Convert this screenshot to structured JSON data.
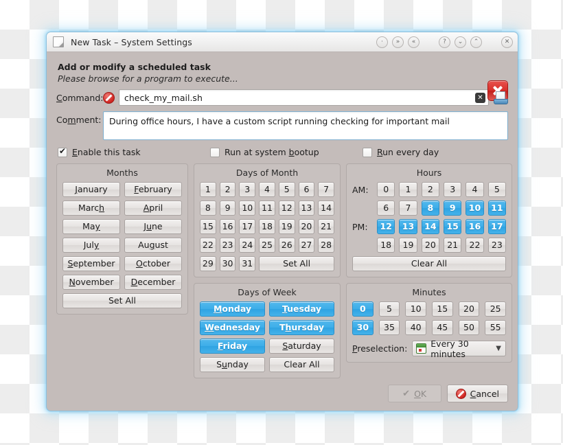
{
  "window": {
    "title": "New Task – System Settings",
    "icon": "document-icon",
    "titlebar_buttons": [
      {
        "name": "keep-above-button",
        "glyph": "·"
      },
      {
        "name": "shade-down-button",
        "glyph": "»"
      },
      {
        "name": "shade-up-button",
        "glyph": "«"
      },
      {
        "name": "help-button",
        "glyph": "?"
      },
      {
        "name": "minimize-button",
        "glyph": "⌄"
      },
      {
        "name": "maximize-button",
        "glyph": "⌃"
      },
      {
        "name": "close-button",
        "glyph": "✕"
      }
    ]
  },
  "header": {
    "title": "Add or modify a scheduled task",
    "subtitle": "Please browse for a program to execute..."
  },
  "command": {
    "label": "Command:",
    "label_mnemonic": "C",
    "value": "check_my_mail.sh",
    "error_icon": "error-prohibited-icon",
    "clear_icon": "clear-text-icon",
    "browse_icon": "browse-file-icon"
  },
  "comment": {
    "label": "Comment:",
    "label_mnemonic": "m",
    "value": "During office hours, I have a custom script running checking for important mail"
  },
  "options": [
    {
      "label": "Enable this task",
      "mnemonic": "E",
      "checked": true,
      "name": "enable-task-checkbox"
    },
    {
      "label": "Run at system bootup",
      "mnemonic": "b",
      "checked": false,
      "name": "run-at-bootup-checkbox"
    },
    {
      "label": "Run every day",
      "mnemonic": "R",
      "checked": false,
      "name": "run-every-day-checkbox"
    }
  ],
  "months": {
    "title": "Months",
    "items": [
      {
        "label": "January",
        "mnemonic": "J",
        "selected": false
      },
      {
        "label": "February",
        "mnemonic": "F",
        "selected": false
      },
      {
        "label": "March",
        "mnemonic": "h",
        "selected": false
      },
      {
        "label": "April",
        "mnemonic": "A",
        "selected": false
      },
      {
        "label": "May",
        "mnemonic": "y",
        "selected": false
      },
      {
        "label": "June",
        "mnemonic": "u",
        "selected": false
      },
      {
        "label": "July",
        "mnemonic": "y",
        "selected": false
      },
      {
        "label": "August",
        "mnemonic": "g",
        "selected": false
      },
      {
        "label": "September",
        "mnemonic": "S",
        "selected": false
      },
      {
        "label": "October",
        "mnemonic": "O",
        "selected": false
      },
      {
        "label": "November",
        "mnemonic": "N",
        "selected": false
      },
      {
        "label": "December",
        "mnemonic": "D",
        "selected": false
      }
    ],
    "action": "Set All"
  },
  "days_of_month": {
    "title": "Days of Month",
    "items": [
      {
        "label": "1",
        "selected": false
      },
      {
        "label": "2",
        "selected": false
      },
      {
        "label": "3",
        "selected": false
      },
      {
        "label": "4",
        "selected": false
      },
      {
        "label": "5",
        "selected": false
      },
      {
        "label": "6",
        "selected": false
      },
      {
        "label": "7",
        "selected": false
      },
      {
        "label": "8",
        "selected": false
      },
      {
        "label": "9",
        "selected": false
      },
      {
        "label": "10",
        "selected": false
      },
      {
        "label": "11",
        "selected": false
      },
      {
        "label": "12",
        "selected": false
      },
      {
        "label": "13",
        "selected": false
      },
      {
        "label": "14",
        "selected": false
      },
      {
        "label": "15",
        "selected": false
      },
      {
        "label": "16",
        "selected": false
      },
      {
        "label": "17",
        "selected": false
      },
      {
        "label": "18",
        "selected": false
      },
      {
        "label": "19",
        "selected": false
      },
      {
        "label": "20",
        "selected": false
      },
      {
        "label": "21",
        "selected": false
      },
      {
        "label": "22",
        "selected": false
      },
      {
        "label": "23",
        "selected": false
      },
      {
        "label": "24",
        "selected": false
      },
      {
        "label": "25",
        "selected": false
      },
      {
        "label": "26",
        "selected": false
      },
      {
        "label": "27",
        "selected": false
      },
      {
        "label": "28",
        "selected": false
      },
      {
        "label": "29",
        "selected": false
      },
      {
        "label": "30",
        "selected": false
      },
      {
        "label": "31",
        "selected": false
      }
    ],
    "action": "Set All"
  },
  "hours": {
    "title": "Hours",
    "am_label": "AM:",
    "pm_label": "PM:",
    "items": [
      {
        "label": "0",
        "selected": false
      },
      {
        "label": "1",
        "selected": false
      },
      {
        "label": "2",
        "selected": false
      },
      {
        "label": "3",
        "selected": false
      },
      {
        "label": "4",
        "selected": false
      },
      {
        "label": "5",
        "selected": false
      },
      {
        "label": "6",
        "selected": false
      },
      {
        "label": "7",
        "selected": false
      },
      {
        "label": "8",
        "selected": true
      },
      {
        "label": "9",
        "selected": true
      },
      {
        "label": "10",
        "selected": true
      },
      {
        "label": "11",
        "selected": true
      },
      {
        "label": "12",
        "selected": true
      },
      {
        "label": "13",
        "selected": true
      },
      {
        "label": "14",
        "selected": true
      },
      {
        "label": "15",
        "selected": true
      },
      {
        "label": "16",
        "selected": true
      },
      {
        "label": "17",
        "selected": true
      },
      {
        "label": "18",
        "selected": false
      },
      {
        "label": "19",
        "selected": false
      },
      {
        "label": "20",
        "selected": false
      },
      {
        "label": "21",
        "selected": false
      },
      {
        "label": "22",
        "selected": false
      },
      {
        "label": "23",
        "selected": false
      }
    ],
    "action": "Clear All"
  },
  "days_of_week": {
    "title": "Days of Week",
    "items": [
      {
        "label": "Monday",
        "mnemonic": "M",
        "selected": true
      },
      {
        "label": "Tuesday",
        "mnemonic": "T",
        "selected": true
      },
      {
        "label": "Wednesday",
        "mnemonic": "W",
        "selected": true
      },
      {
        "label": "Thursday",
        "mnemonic": "h",
        "selected": true
      },
      {
        "label": "Friday",
        "mnemonic": "F",
        "selected": true
      },
      {
        "label": "Saturday",
        "mnemonic": "S",
        "selected": false
      },
      {
        "label": "Sunday",
        "mnemonic": "u",
        "selected": false
      }
    ],
    "action": "Clear All"
  },
  "minutes": {
    "title": "Minutes",
    "items": [
      {
        "label": "0",
        "selected": true
      },
      {
        "label": "5",
        "selected": false
      },
      {
        "label": "10",
        "selected": false
      },
      {
        "label": "15",
        "selected": false
      },
      {
        "label": "20",
        "selected": false
      },
      {
        "label": "25",
        "selected": false
      },
      {
        "label": "30",
        "selected": true
      },
      {
        "label": "35",
        "selected": false
      },
      {
        "label": "40",
        "selected": false
      },
      {
        "label": "45",
        "selected": false
      },
      {
        "label": "50",
        "selected": false
      },
      {
        "label": "55",
        "selected": false
      }
    ],
    "preselection_label": "Preselection:",
    "preselection_mnemonic": "P",
    "preselection_value": "Every 30 minutes",
    "preselection_icon": "calendar-icon"
  },
  "footer": {
    "ok_label": "OK",
    "ok_mnemonic": "O",
    "ok_enabled": false,
    "cancel_label": "Cancel",
    "cancel_mnemonic": "C"
  },
  "colors": {
    "selection_blue": "#3daee9",
    "dialog_bg": "#c4bcba",
    "error_red": "#cf2420"
  }
}
